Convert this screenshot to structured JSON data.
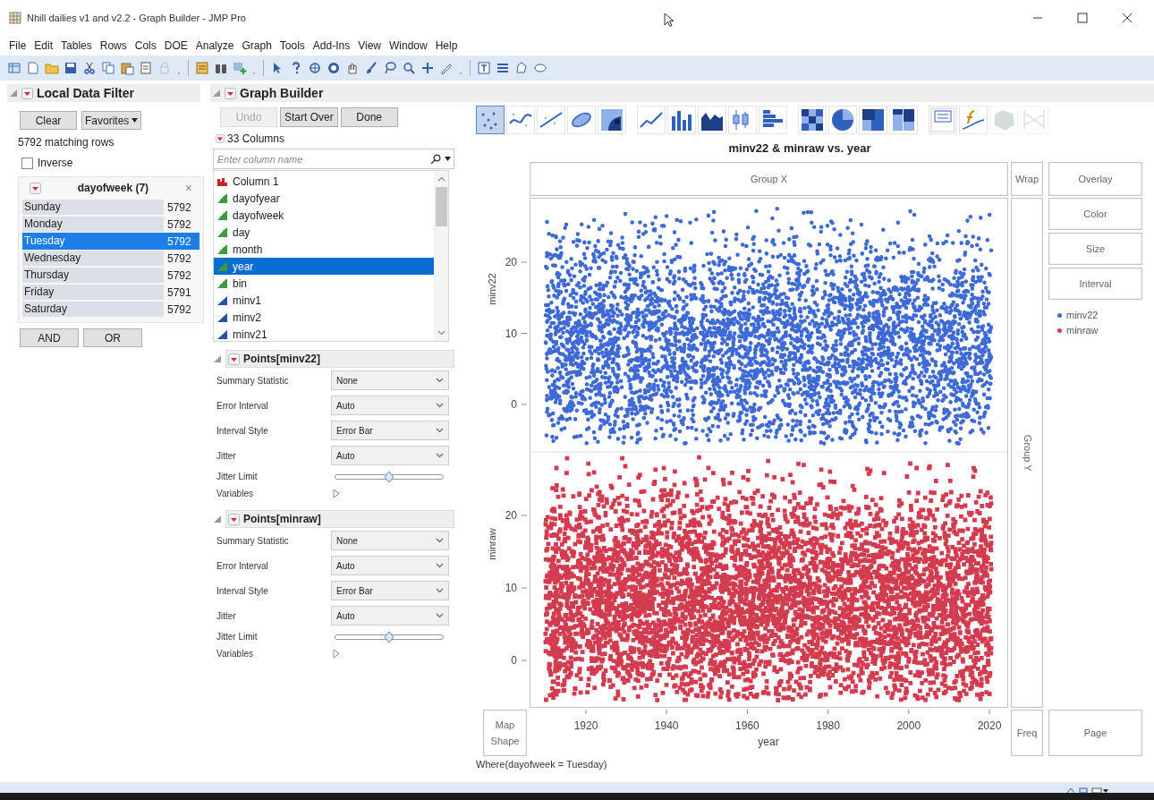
{
  "window": {
    "title": "Nhill dailies v1 and v2.2 - Graph Builder - JMP Pro"
  },
  "menu": [
    "File",
    "Edit",
    "Tables",
    "Rows",
    "Cols",
    "DOE",
    "Analyze",
    "Graph",
    "Tools",
    "Add-Ins",
    "View",
    "Window",
    "Help"
  ],
  "data_filter": {
    "title": "Local Data Filter",
    "clear": "Clear",
    "favorites": "Favorites",
    "matching": "5792 matching rows",
    "inverse": {
      "label": "Inverse",
      "checked": false
    },
    "column": {
      "title": "dayofweek (7)",
      "close": "×",
      "levels": [
        {
          "label": "Sunday",
          "count": "5792",
          "selected": false
        },
        {
          "label": "Monday",
          "count": "5792",
          "selected": false
        },
        {
          "label": "Tuesday",
          "count": "5792",
          "selected": true
        },
        {
          "label": "Wednesday",
          "count": "5792",
          "selected": false
        },
        {
          "label": "Thursday",
          "count": "5792",
          "selected": false
        },
        {
          "label": "Friday",
          "count": "5791",
          "selected": false
        },
        {
          "label": "Saturday",
          "count": "5792",
          "selected": false
        }
      ]
    },
    "logic_buttons": [
      "AND",
      "OR"
    ]
  },
  "graph_builder": {
    "title": "Graph Builder",
    "buttons": [
      {
        "label": "Undo",
        "disabled": true
      },
      {
        "label": "Start Over",
        "disabled": false
      },
      {
        "label": "Done",
        "disabled": false
      }
    ],
    "columns_label": "33 Columns",
    "search": {
      "placeholder": "Enter column name"
    },
    "columns": [
      {
        "name": "Column 1",
        "kind": "nominal",
        "selected": false
      },
      {
        "name": "dayofyear",
        "kind": "ordinal",
        "selected": false
      },
      {
        "name": "dayofweek",
        "kind": "ordinal",
        "selected": false
      },
      {
        "name": "day",
        "kind": "ordinal",
        "selected": false
      },
      {
        "name": "month",
        "kind": "ordinal",
        "selected": false
      },
      {
        "name": "year",
        "kind": "ordinal",
        "selected": true
      },
      {
        "name": "bin",
        "kind": "ordinal",
        "selected": false
      },
      {
        "name": "minv1",
        "kind": "continuous",
        "selected": false
      },
      {
        "name": "minv2",
        "kind": "continuous",
        "selected": false
      },
      {
        "name": "minv21",
        "kind": "continuous",
        "selected": false
      }
    ],
    "points_sections": [
      {
        "title": "Points[minv22]",
        "options": [
          {
            "kind": "dropdown",
            "label": "Summary Statistic",
            "value": "None"
          },
          {
            "kind": "dropdown",
            "label": "Error Interval",
            "value": "Auto"
          },
          {
            "kind": "dropdown",
            "label": "Interval Style",
            "value": "Error Bar"
          },
          {
            "kind": "dropdown",
            "label": "Jitter",
            "value": "Auto"
          },
          {
            "kind": "slider",
            "label": "Jitter Limit",
            "level": 0.5
          },
          {
            "kind": "expander",
            "label": "Variables"
          }
        ]
      },
      {
        "title": "Points[minraw]",
        "options": [
          {
            "kind": "dropdown",
            "label": "Summary Statistic",
            "value": "None"
          },
          {
            "kind": "dropdown",
            "label": "Error Interval",
            "value": "Auto"
          },
          {
            "kind": "dropdown",
            "label": "Interval Style",
            "value": "Error Bar"
          },
          {
            "kind": "dropdown",
            "label": "Jitter",
            "value": "Auto"
          },
          {
            "kind": "slider",
            "label": "Jitter Limit",
            "level": 0.5
          },
          {
            "kind": "expander",
            "label": "Variables"
          }
        ]
      }
    ]
  },
  "element_buttons": [
    {
      "kind": "points",
      "selected": true,
      "disabled": false
    },
    {
      "kind": "smoother",
      "selected": false,
      "disabled": false
    },
    {
      "kind": "line_of_fit",
      "selected": false,
      "disabled": false
    },
    {
      "kind": "ellipse",
      "selected": false,
      "disabled": false
    },
    {
      "kind": "contour",
      "selected": false,
      "disabled": false
    },
    {
      "kind": "line",
      "selected": false,
      "disabled": false
    },
    {
      "kind": "bar",
      "selected": false,
      "disabled": false
    },
    {
      "kind": "area",
      "selected": false,
      "disabled": false
    },
    {
      "kind": "box_plot",
      "selected": false,
      "disabled": false
    },
    {
      "kind": "histogram",
      "selected": false,
      "disabled": false
    },
    {
      "kind": "heatmap",
      "selected": false,
      "disabled": false
    },
    {
      "kind": "pie",
      "selected": false,
      "disabled": false
    },
    {
      "kind": "treemap",
      "selected": false,
      "disabled": false
    },
    {
      "kind": "mosaic",
      "selected": false,
      "disabled": false
    },
    {
      "kind": "caption_box",
      "selected": false,
      "disabled": false
    },
    {
      "kind": "formula",
      "selected": false,
      "disabled": false
    },
    {
      "kind": "map_shapes",
      "selected": false,
      "disabled": true
    },
    {
      "kind": "parallel",
      "selected": false,
      "disabled": true
    }
  ],
  "chart": {
    "title": "minv22 & minraw vs. year",
    "y_axes": [
      {
        "title": "minv22",
        "ticks": [
          "20",
          "10",
          "0"
        ]
      },
      {
        "title": "minraw",
        "ticks": [
          "20",
          "10",
          "0"
        ]
      }
    ],
    "x_axis": {
      "title": "year",
      "ticks": [
        "1920",
        "1940",
        "1960",
        "1980",
        "2000",
        "2020"
      ]
    },
    "legend": [
      {
        "label": "minv22",
        "color": "#3d6ad6"
      },
      {
        "label": "minraw",
        "color": "#d23c4e"
      }
    ],
    "filter_note": "Where(dayofweek = Tuesday)"
  },
  "drop_zones": {
    "group_x": "Group X",
    "wrap": "Wrap",
    "overlay": "Overlay",
    "color_by": "Color",
    "size": "Size",
    "interval": "Interval",
    "group_y": "Group Y",
    "map_shape": "Map Shape",
    "freq": "Freq",
    "page": "Page"
  }
}
